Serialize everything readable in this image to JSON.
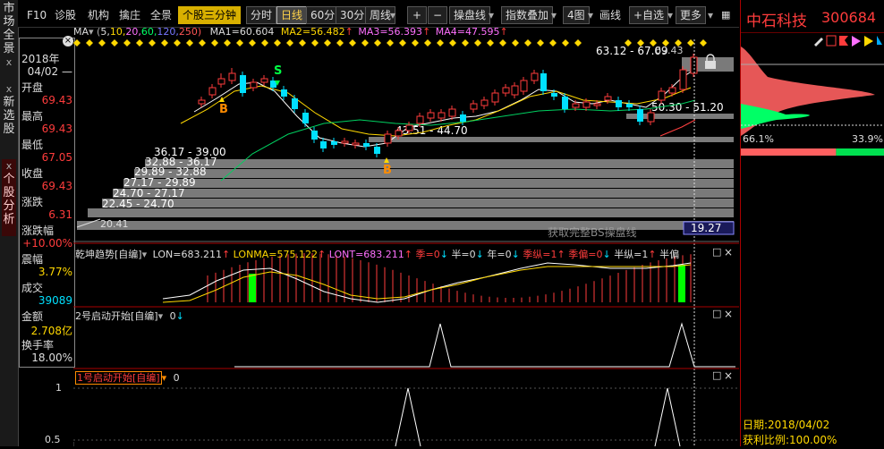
{
  "sidebar": {
    "tabs": [
      {
        "label": "市场全景",
        "close": "x"
      },
      {
        "label": "新选股",
        "close": "x"
      },
      {
        "label": "个股分析",
        "close": "x"
      }
    ]
  },
  "toolbar": {
    "f10": "F10",
    "diagnose": "诊股",
    "institution": "机构",
    "hedge": "擒庄",
    "panorama": "全景",
    "three_min": "个股三分钟",
    "timeshare": "分时",
    "daily": "日线",
    "min60": "60分",
    "min30": "30分",
    "weekly": "周线",
    "plus": "+",
    "minus": "−",
    "trading_line": "操盘线",
    "index_overlay": "指数叠加",
    "four_chart": "4图",
    "draw_line": "画线",
    "add_watch": "+自选",
    "more": "更多"
  },
  "ma": {
    "label": "MA",
    "params": "(5,10,20,60,120,250)",
    "p1": "5,",
    "p2": "10,",
    "p3": "20,",
    "p4": "60,",
    "p5": "120,",
    "p6": "250)",
    "ma1": "MA1=60.604",
    "ma2": "MA2=56.482",
    "ma3": "MA3=56.393",
    "ma4": "MA4=47.595"
  },
  "info": {
    "year": "2018年",
    "date": "04/02 —",
    "open_label": "开盘",
    "open": "69.43",
    "high_label": "最高",
    "high": "69.43",
    "low_label": "最低",
    "low": "67.05",
    "close_label": "收盘",
    "close": "69.43",
    "chg_label": "涨跌",
    "chg": "6.31",
    "pct_label": "涨跌幅",
    "pct": "+10.00%",
    "amp_label": "震幅",
    "amp": "3.77%",
    "vol_label": "成交",
    "vol": "39089",
    "amt_label": "金额",
    "amt": "2.708亿",
    "turn_label": "换手率",
    "turn": "18.00%"
  },
  "main_chart": {
    "top_range": "63.12 - 67.09",
    "top_price": "69.43",
    "right_range": "50.30 - 51.20",
    "mid_range": "43.51 - 44.70",
    "bottom_price": "20.41",
    "current_price": "19.27",
    "marker_b": "B",
    "marker_s": "S",
    "watermark": "获取完整BS操盘线",
    "ladder": [
      "36.17 - 39.00",
      "32.88 - 36.17",
      "29.89 - 32.88",
      "27.17 - 29.89",
      "24.70 - 27.17",
      "22.45 - 24.70"
    ]
  },
  "indicator1": {
    "name": "乾坤趋势[自编]",
    "lon": "LON=683.211",
    "lonma": "LONMA=575.122",
    "lont": "LONT=683.211",
    "ji": "季=0",
    "ban": "半=0",
    "nian": "年=0",
    "jiz": "季纵=1",
    "jip": "季偏=0",
    "banz": "半纵=1",
    "more": "半偏"
  },
  "indicator2": {
    "name": "2号启动开始[自编]",
    "val": "0",
    "arrow": "↓"
  },
  "indicator3": {
    "name": "1号启动开始[自编]",
    "val": "0",
    "y1": "1",
    "y2": "0.5"
  },
  "panel_icons": {
    "up": "□",
    "close": "×"
  },
  "stock": {
    "name": "中石科技",
    "code": "300684",
    "left_pct": "66.1%",
    "right_pct": "33.9%",
    "date_label": "日期:2018/04/02",
    "profit_label": "获利比例:100.00%",
    "left_ratio": 0.661
  },
  "colors": {
    "up": "#ff3c3c",
    "down": "#00e0ff",
    "yellow": "#ffd800",
    "green": "#00ff00",
    "bg": "#000000"
  }
}
